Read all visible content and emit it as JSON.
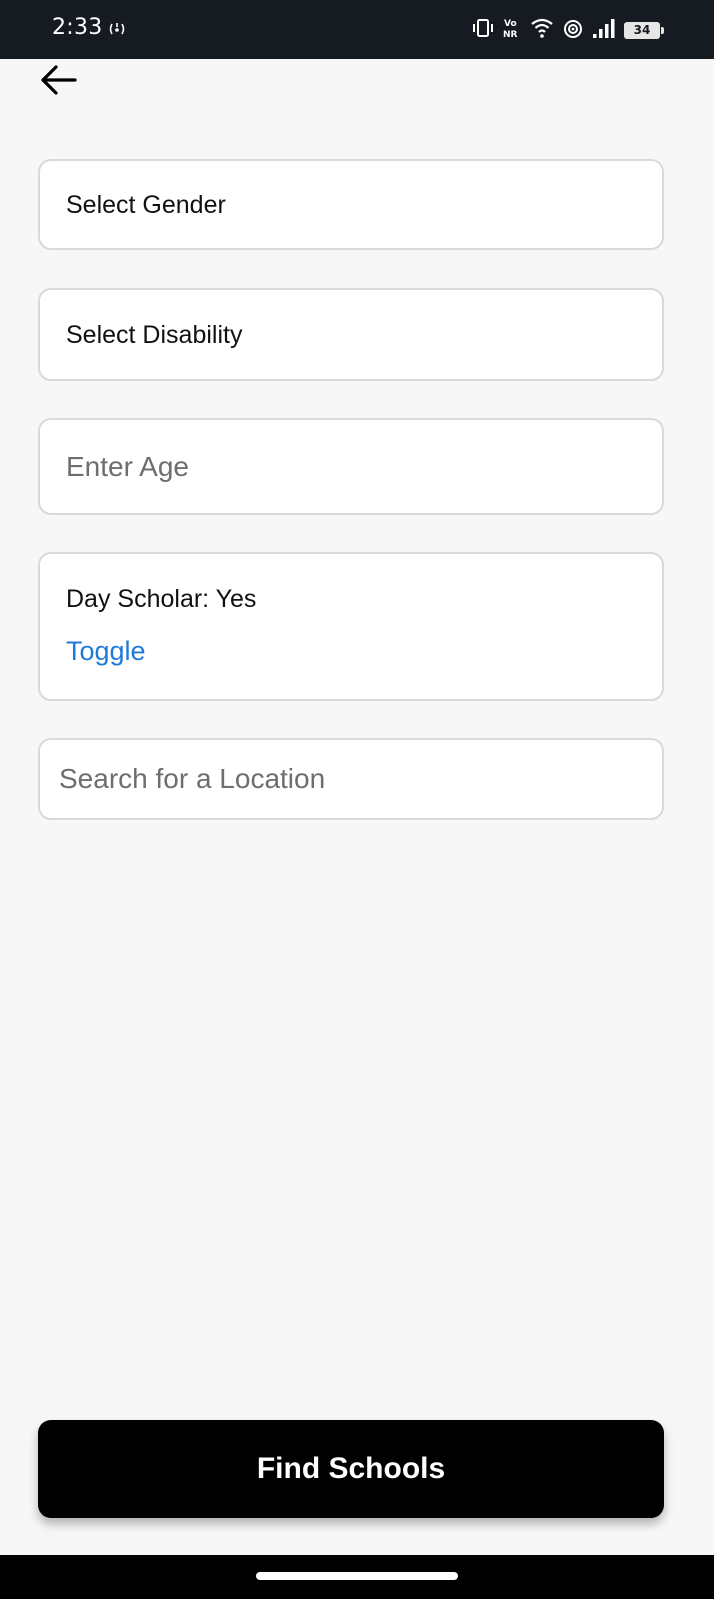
{
  "status_bar": {
    "time": "2:33",
    "battery": "34"
  },
  "form": {
    "gender_label": "Select Gender",
    "disability_label": "Select Disability",
    "age_placeholder": "Enter Age",
    "age_value": "",
    "day_scholar_text": "Day Scholar: Yes",
    "toggle_label": "Toggle",
    "location_placeholder": "Search for a Location",
    "location_value": ""
  },
  "actions": {
    "find_schools_label": "Find Schools"
  },
  "icons": {
    "back": "back-arrow-icon",
    "hotspot": "hotspot-icon",
    "vibrate": "vibrate-icon",
    "vonr": "vonr-icon",
    "wifi": "wifi-icon",
    "signal": "signal-icon",
    "battery": "battery-icon"
  },
  "colors": {
    "background": "#f7f7f7",
    "status_bar": "#161b22",
    "field_border": "#d9d9d9",
    "link": "#1e7bd9",
    "primary_button": "#000000"
  }
}
